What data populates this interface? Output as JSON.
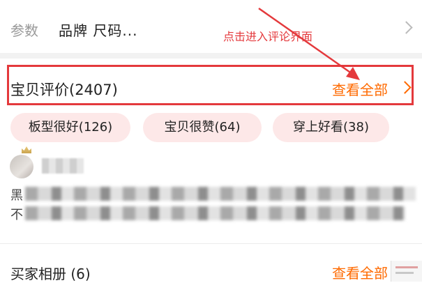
{
  "params": {
    "label": "参数",
    "value": "品牌 尺码..."
  },
  "annotation": {
    "text": "点击进入评论界面"
  },
  "reviews": {
    "title": "宝贝评价(2407)",
    "view_all": "查看全部",
    "tags": [
      "板型很好(126)",
      "宝贝很赞(64)",
      "穿上好看(38)"
    ],
    "comment_lead_1": "黑",
    "comment_lead_2": "不"
  },
  "album": {
    "title": "买家相册 (6)",
    "view_all": "查看全部"
  },
  "colors": {
    "accent": "#ff6a00",
    "annotation_red": "#e4393c",
    "tag_bg": "#fde8e8"
  },
  "icons": [
    "chevron-right-icon",
    "annotation-arrow-icon",
    "crown-icon"
  ]
}
